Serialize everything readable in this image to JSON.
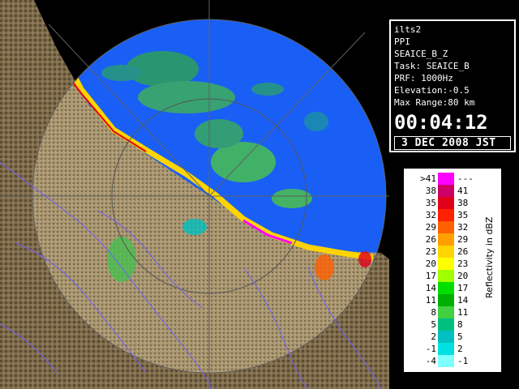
{
  "info": {
    "site": "ilts2",
    "product": "PPI",
    "field": "SEAICE_B_Z",
    "task": "Task: SEAICE_B",
    "prf": "PRF: 1000Hz",
    "elevation": "Elevation:-0.5",
    "max_range": "Max Range:80 km",
    "time": "00:04:12",
    "date": "3 DEC 2008 JST"
  },
  "legend": {
    "title": "Reflectivity in dBZ",
    "rows": [
      {
        "left": ">41",
        "right": "---",
        "color": "#ff00ff"
      },
      {
        "left": "38",
        "right": "41",
        "color": "#cc0066"
      },
      {
        "left": "35",
        "right": "38",
        "color": "#e0001a"
      },
      {
        "left": "32",
        "right": "35",
        "color": "#ff2000"
      },
      {
        "left": "29",
        "right": "32",
        "color": "#ff6000"
      },
      {
        "left": "26",
        "right": "29",
        "color": "#ffa000"
      },
      {
        "left": "23",
        "right": "26",
        "color": "#ffd400"
      },
      {
        "left": "20",
        "right": "23",
        "color": "#ffff00"
      },
      {
        "left": "17",
        "right": "20",
        "color": "#a0ff00"
      },
      {
        "left": "14",
        "right": "17",
        "color": "#00e000"
      },
      {
        "left": "11",
        "right": "14",
        "color": "#00b000"
      },
      {
        "left": "8",
        "right": "11",
        "color": "#40d040"
      },
      {
        "left": "5",
        "right": "8",
        "color": "#00c080"
      },
      {
        "left": "2",
        "right": "5",
        "color": "#00c0c0"
      },
      {
        "left": "-1",
        "right": "2",
        "color": "#00e0e0"
      },
      {
        "left": "-4",
        "right": "-1",
        "color": "#80ffff"
      }
    ]
  },
  "colors": {
    "sea": "#1a5ff5",
    "land": "#7a6a4e",
    "land_dark": "#5a4a32",
    "rivers": "#7060ff"
  }
}
